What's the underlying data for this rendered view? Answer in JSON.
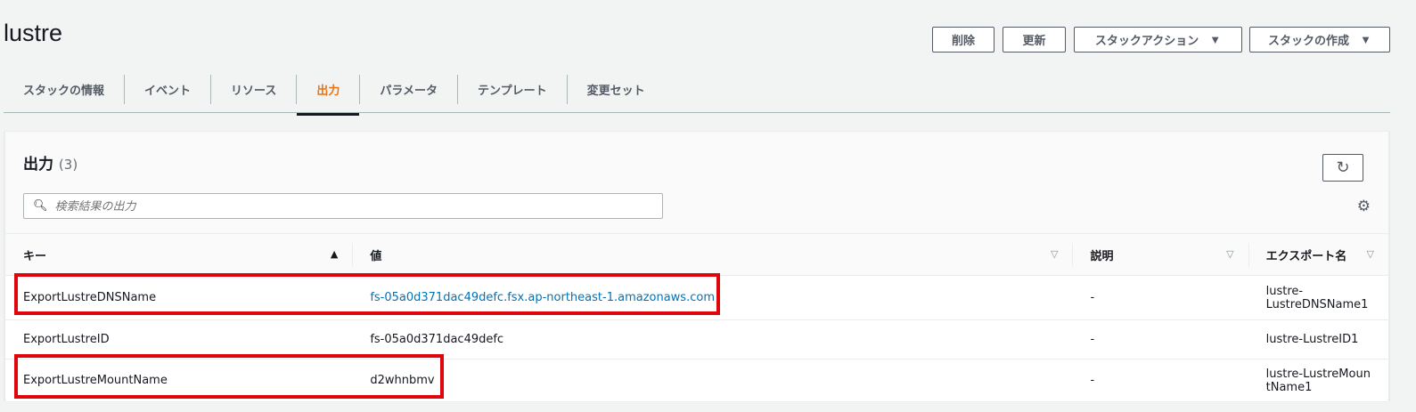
{
  "header": {
    "title": "lustre",
    "buttons": {
      "delete": "削除",
      "update": "更新",
      "stack_actions": "スタックアクション",
      "create_stack": "スタックの作成"
    }
  },
  "tabs": [
    "スタックの情報",
    "イベント",
    "リソース",
    "出力",
    "パラメータ",
    "テンプレート",
    "変更セット"
  ],
  "active_tab": "出力",
  "panel": {
    "title": "出力",
    "count": "(3)",
    "search_placeholder": "検索結果の出力"
  },
  "table": {
    "columns": [
      "キー",
      "値",
      "説明",
      "エクスポート名"
    ],
    "rows": [
      {
        "key": "ExportLustreDNSName",
        "value": "fs-05a0d371dac49defc.fsx.ap-northeast-1.amazonaws.com",
        "desc": "-",
        "export": "lustre-LustreDNSName1"
      },
      {
        "key": "ExportLustreID",
        "value": "fs-05a0d371dac49defc",
        "desc": "-",
        "export": "lustre-LustreID1"
      },
      {
        "key": "ExportLustreMountName",
        "value": "d2whnbmv",
        "desc": "-",
        "export": "lustre-LustreMountName1"
      }
    ]
  }
}
